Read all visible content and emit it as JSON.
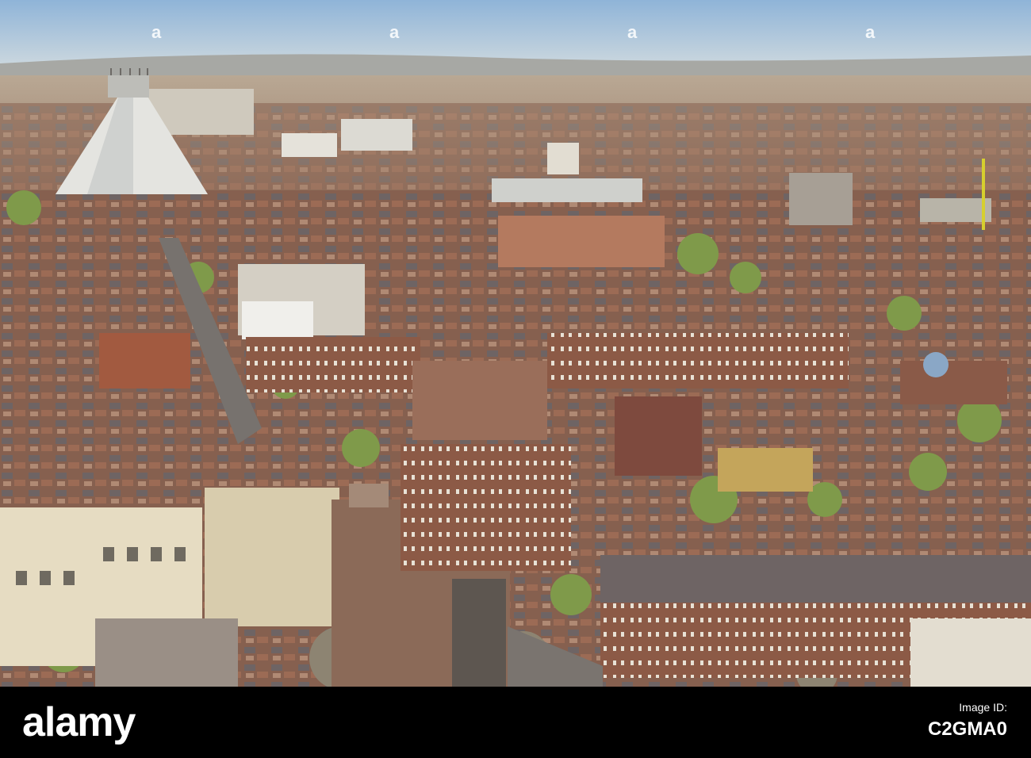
{
  "photo": {
    "subject": "aerial-city-view",
    "colors": {
      "sky_top": "#8fb4d8",
      "sky_horizon": "#c9d6de",
      "haze": "#b9a894",
      "brick": "#8c5a46",
      "roof": "#6e6464",
      "foliage": "#7f9a4a",
      "concrete": "#d9d6cc"
    }
  },
  "watermark": {
    "brand": "alamy",
    "id_label": "Image ID:",
    "id_value": "C2GMA0",
    "logo_letter": "a"
  }
}
